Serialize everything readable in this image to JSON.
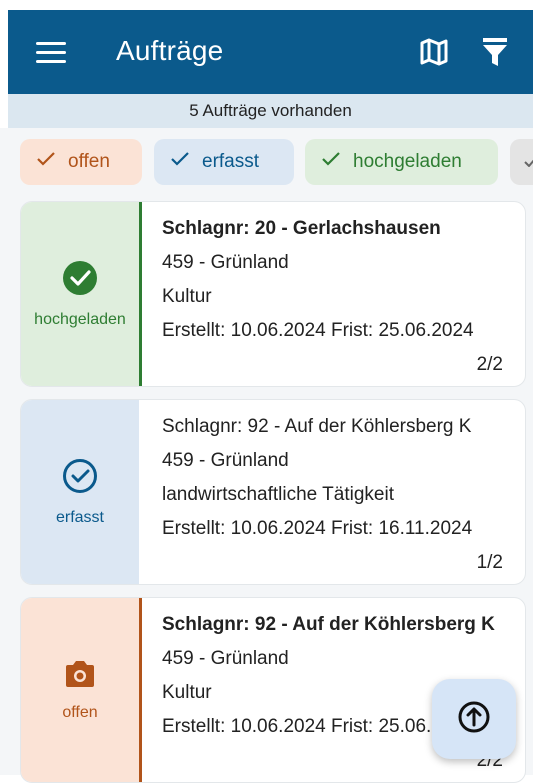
{
  "appbar": {
    "title": "Aufträge"
  },
  "summary": {
    "count_text": "5 Aufträge vorhanden"
  },
  "filters": [
    {
      "label": "offen",
      "icon": "check-icon",
      "color": "#b1541a"
    },
    {
      "label": "erfasst",
      "icon": "check-icon",
      "color": "#0b5a8c"
    },
    {
      "label": "hochgeladen",
      "icon": "check-icon",
      "color": "#2e7d32"
    }
  ],
  "orders": [
    {
      "status": "hochgeladen",
      "status_icon": "check-circle-filled-icon",
      "status_color": "#2e7d32",
      "title": "Schlagnr: 20 - Gerlachshausen",
      "line2": "459 - Grünland",
      "line3": "Kultur",
      "created": "Erstellt: 10.06.2024",
      "deadline": "Frist: 25.06.2024",
      "page": "2/2"
    },
    {
      "status": "erfasst",
      "status_icon": "check-circle-outline-icon",
      "status_color": "#0b5a8c",
      "title": "Schlagnr: 92 - Auf der Köhlersberg K",
      "line2": "459 - Grünland",
      "line3": "landwirtschaftliche Tätigkeit",
      "created": "Erstellt: 10.06.2024",
      "deadline": "Frist: 16.11.2024",
      "page": "1/2"
    },
    {
      "status": "offen",
      "status_icon": "camera-icon",
      "status_color": "#b1541a",
      "title": "Schlagnr: 92 - Auf der Köhlersberg K",
      "line2": "459 - Grünland",
      "line3": "Kultur",
      "created": "Erstellt: 10.06.2024",
      "deadline": "Frist: 25.06.2024",
      "page": "2/2"
    }
  ],
  "icons": {
    "menu": "menu-icon",
    "map": "map-icon",
    "filter": "filter-icon",
    "scroll_top": "arrow-up-circle-icon"
  },
  "colors": {
    "appbar": "#0b5a8c",
    "offen": "#b1541a",
    "erfasst": "#0b5a8c",
    "hochgeladen": "#2e7d32"
  }
}
